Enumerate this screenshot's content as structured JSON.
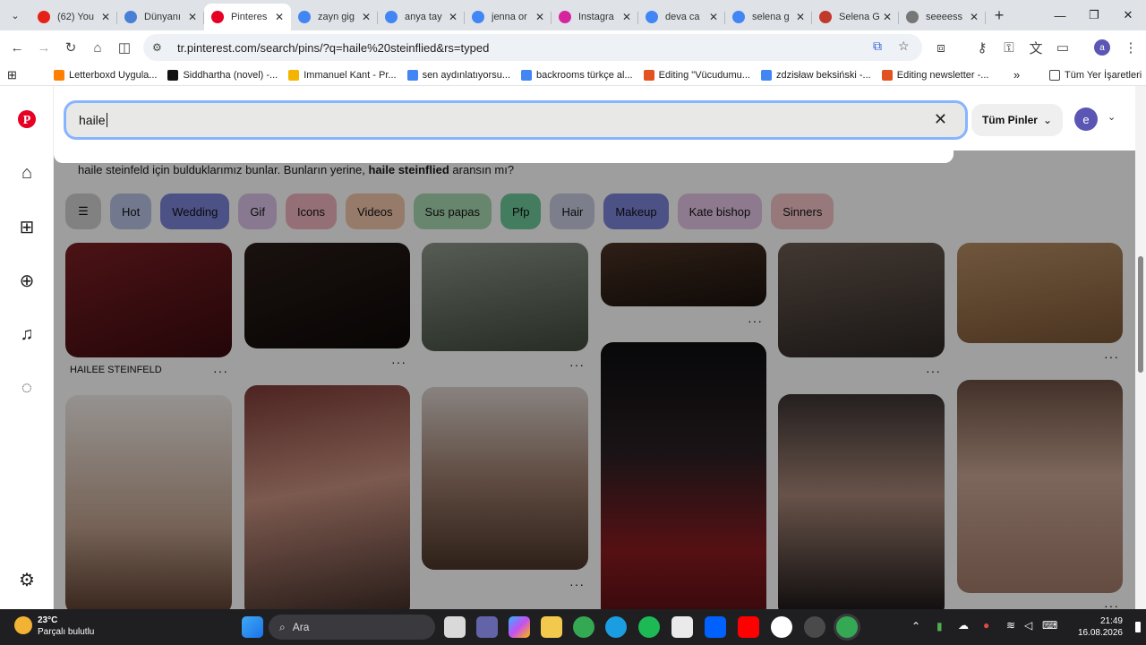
{
  "browser": {
    "tabs": [
      {
        "title": "(62) You",
        "color": "#e62117",
        "icon": "youtube-icon",
        "active": false
      },
      {
        "title": "Dünyanı",
        "color": "#4a7fd6",
        "icon": "page-icon",
        "active": false
      },
      {
        "title": "Pinteres",
        "color": "#e60023",
        "icon": "pinterest-icon",
        "active": true
      },
      {
        "title": "zayn gig",
        "color": "#4285f4",
        "icon": "google-icon",
        "active": false
      },
      {
        "title": "anya tay",
        "color": "#4285f4",
        "icon": "google-icon",
        "active": false
      },
      {
        "title": "jenna or",
        "color": "#4285f4",
        "icon": "google-icon",
        "active": false
      },
      {
        "title": "Instagra",
        "color": "#d6249f",
        "icon": "instagram-icon",
        "active": false
      },
      {
        "title": "deva ca",
        "color": "#4285f4",
        "icon": "google-icon",
        "active": false
      },
      {
        "title": "selena g",
        "color": "#4285f4",
        "icon": "google-icon",
        "active": false
      },
      {
        "title": "Selena G",
        "color": "#c0392b",
        "icon": "netflix-icon",
        "active": false
      },
      {
        "title": "seeeess",
        "color": "#777777",
        "icon": "globe-icon",
        "active": false
      }
    ],
    "url": "tr.pinterest.com/search/pins/?q=haile%20steinflied&rs=typed",
    "bookmarks": [
      {
        "label": "Letterboxd Uygula...",
        "color": "#ff8000"
      },
      {
        "label": "Siddhartha (novel) -...",
        "color": "#111111"
      },
      {
        "label": "Immanuel Kant - Pr...",
        "color": "#f4b400"
      },
      {
        "label": "sen aydınlatıyorsu...",
        "color": "#4285f4"
      },
      {
        "label": "backrooms türkçe al...",
        "color": "#4285f4"
      },
      {
        "label": "Editing \"Vücudumu...",
        "color": "#e2531f"
      },
      {
        "label": "zdzisław beksiński -...",
        "color": "#4285f4"
      },
      {
        "label": "Editing newsletter -...",
        "color": "#e2531f"
      }
    ],
    "all_bookmarks": "Tüm Yer İşaretleri",
    "profile_letter": "a"
  },
  "pinterest": {
    "search_value": "haile",
    "filter_label": "Tüm Pinler",
    "avatar_letter": "e",
    "did_you_mean_prefix": "haile steinfeld için bulduklarımız bunlar. Bunların yerine,",
    "did_you_mean_term": "haile steinflied",
    "did_you_mean_suffix": "aransın mı?",
    "chips": [
      {
        "label": "Hot",
        "color": "#b9c4e6"
      },
      {
        "label": "Wedding",
        "color": "#7b83d9"
      },
      {
        "label": "Gif",
        "color": "#dcc4e8"
      },
      {
        "label": "Icons",
        "color": "#f0b4bf"
      },
      {
        "label": "Videos",
        "color": "#f2c6ab"
      },
      {
        "label": "Sus papas",
        "color": "#a7d9b0"
      },
      {
        "label": "Pfp",
        "color": "#6cc99a"
      },
      {
        "label": "Hair",
        "color": "#c8cce0"
      },
      {
        "label": "Makeup",
        "color": "#7b83d9"
      },
      {
        "label": "Kate bishop",
        "color": "#e5c6e6"
      },
      {
        "label": "Sinners",
        "color": "#f4c4c9"
      }
    ],
    "pin_caption": "HAILEE STEINFELD",
    "more": "···"
  },
  "taskbar": {
    "temp": "23°C",
    "weather": "Parçalı bulutlu",
    "search": "Ara",
    "time": "21:49",
    "date": "16.08.2026"
  }
}
